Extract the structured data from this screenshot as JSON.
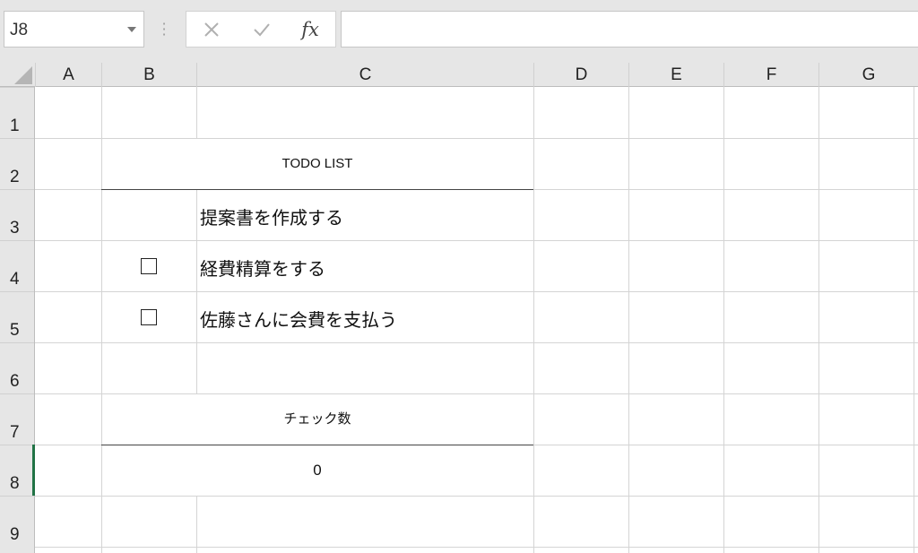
{
  "formula_bar": {
    "name_box": "J8",
    "cancel_icon": "close-icon",
    "enter_icon": "check-icon",
    "function_label": "fx",
    "formula": ""
  },
  "columns": [
    "A",
    "B",
    "C",
    "D",
    "E",
    "F",
    "G"
  ],
  "rows": [
    "1",
    "2",
    "3",
    "4",
    "5",
    "6",
    "7",
    "8",
    "9"
  ],
  "selected_cell": "J8",
  "sheet": {
    "todo_title": "TODO LIST",
    "tasks": [
      {
        "label": "提案書を作成する",
        "has_checkbox": false
      },
      {
        "label": "経費精算をする",
        "has_checkbox": true
      },
      {
        "label": "佐藤さんに会費を支払う",
        "has_checkbox": true
      }
    ],
    "check_count_label": "チェック数",
    "check_count_value": "0"
  }
}
